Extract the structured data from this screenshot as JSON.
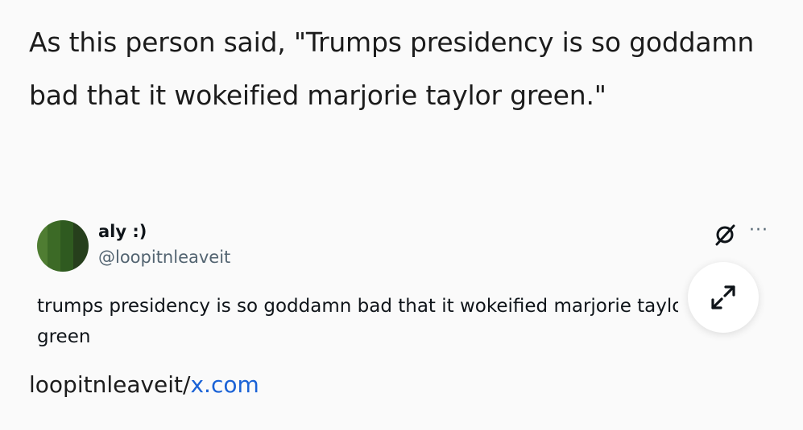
{
  "post": {
    "text": "As this person said, \"Trumps presidency is so goddamn bad that it wokeified marjorie taylor green.\""
  },
  "embed": {
    "display_name": "aly :)",
    "handle": "@loopitnleaveit",
    "tweet_line1": "trumps presidency is so goddamn bad that it wokeified marjorie taylor",
    "tweet_line2": "green",
    "more_label": "···",
    "icons": {
      "logo": "x-logo-icon",
      "more": "more-icon",
      "expand": "expand-icon"
    }
  },
  "source": {
    "prefix": "loopitnleaveit/",
    "link_text": "x.com",
    "link_color": "#1a62d6"
  }
}
